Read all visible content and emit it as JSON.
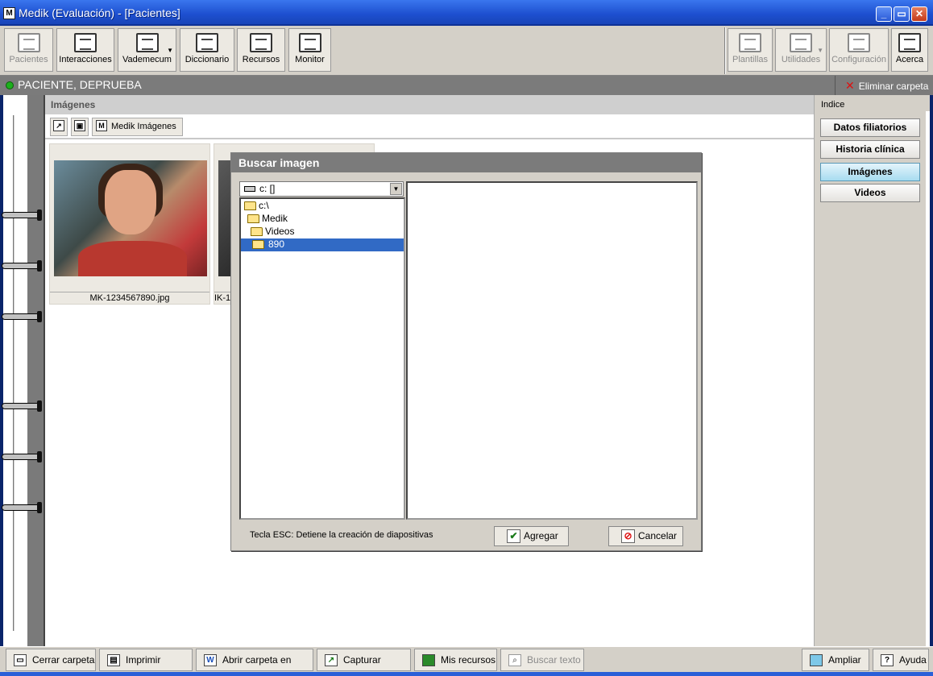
{
  "window": {
    "title": "Medik (Evaluación) - [Pacientes]",
    "app_icon": "M",
    "min": "_",
    "max": "▭",
    "close": "✕"
  },
  "toolbar": {
    "items": [
      {
        "label": "Pacientes",
        "icon": "patients-icon"
      },
      {
        "label": "Interacciones",
        "icon": "interactions-icon"
      },
      {
        "label": "Vademecum",
        "icon": "vademecum-icon"
      },
      {
        "label": "Diccionario",
        "icon": "dictionary-icon"
      },
      {
        "label": "Recursos",
        "icon": "resources-icon"
      },
      {
        "label": "Monitor",
        "icon": "monitor-icon"
      },
      {
        "label": "Plantillas",
        "icon": "templates-icon"
      },
      {
        "label": "Utilidades",
        "icon": "utilities-icon"
      },
      {
        "label": "Configuración",
        "icon": "settings-icon"
      },
      {
        "label": "Acerca",
        "icon": "about-icon"
      }
    ]
  },
  "patient": {
    "name": "PACIENTE, DEPRUEBA",
    "status_color": "#1cb01c",
    "delete_folder": "Eliminar carpeta"
  },
  "images_section": {
    "title": "Imágenes",
    "medik_images_button": "Medik Imágenes",
    "thumbnails": [
      {
        "filename": "MK-1234567890.jpg"
      },
      {
        "filename": "IK-1"
      }
    ]
  },
  "right_panel": {
    "index_label": "Indice",
    "items": [
      {
        "label": "Datos filiatorios"
      },
      {
        "label": "Historia clínica"
      },
      {
        "label": "Imágenes",
        "active": true
      },
      {
        "label": "Videos"
      }
    ],
    "active_color": "#a7dcf0"
  },
  "dialog": {
    "title": "Buscar imagen",
    "drive": "c: []",
    "tree": [
      {
        "label": "c:\\"
      },
      {
        "label": "Medik"
      },
      {
        "label": "Videos"
      },
      {
        "label": "890",
        "selected": true
      }
    ],
    "hint": "Tecla ESC: Detiene la creación de diapositivas",
    "add_button": "Agregar",
    "cancel_button": "Cancelar",
    "add_icon_glyph": "✔",
    "cancel_icon_glyph": "⊘"
  },
  "bottom_bar": {
    "buttons": [
      {
        "label": "Cerrar carpeta",
        "icon": "folder-icon"
      },
      {
        "label": "Imprimir carpeta",
        "icon": "printer-icon"
      },
      {
        "label": "Abrir carpeta en Word",
        "icon": "word-icon"
      },
      {
        "label": "Capturar imagen",
        "icon": "capture-icon"
      },
      {
        "label": "Mis recursos",
        "icon": "resources-icon"
      },
      {
        "label": "Buscar texto",
        "icon": "search-icon",
        "disabled": true
      },
      {
        "label": "Ampliar",
        "icon": "zoom-icon"
      },
      {
        "label": "Ayuda",
        "icon": "help-icon"
      }
    ]
  },
  "colors": {
    "titlebar": "#1d4fcf",
    "header_gray": "#7b7b7b",
    "selection": "#316ac5"
  }
}
